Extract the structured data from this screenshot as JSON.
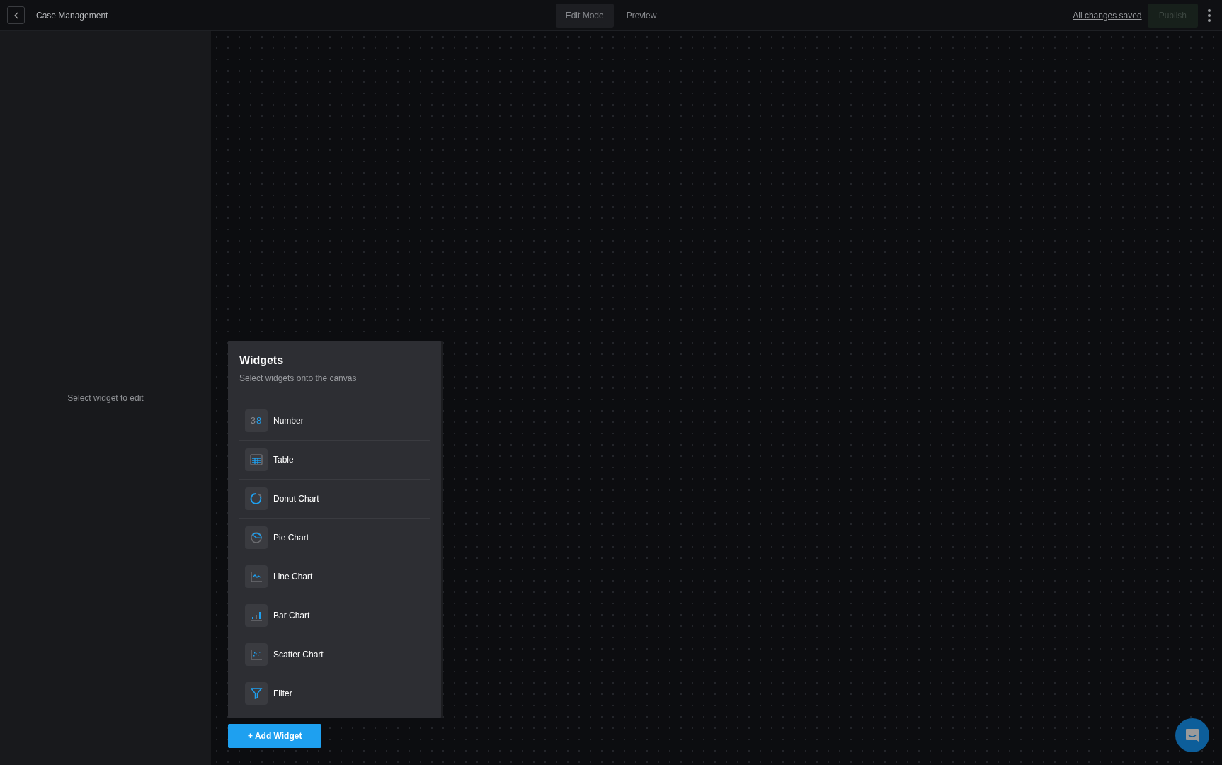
{
  "header": {
    "back_button": true,
    "title": "Case Management",
    "tabs": [
      {
        "label": "Edit Mode",
        "selected": true
      },
      {
        "label": "Preview",
        "selected": false
      }
    ],
    "save_status": "All changes saved",
    "publish": {
      "label": "Publish",
      "disabled": true
    }
  },
  "sidebar": {
    "empty_message": "Select widget to edit"
  },
  "widgets_panel": {
    "title": "Widgets",
    "subtitle": "Select widgets onto the canvas",
    "items": [
      {
        "kind": "number",
        "label": "Number",
        "icon_text": "38"
      },
      {
        "kind": "table",
        "label": "Table"
      },
      {
        "kind": "donut",
        "label": "Donut Chart"
      },
      {
        "kind": "pie",
        "label": "Pie Chart"
      },
      {
        "kind": "line",
        "label": "Line Chart"
      },
      {
        "kind": "bar",
        "label": "Bar Chart"
      },
      {
        "kind": "scatter",
        "label": "Scatter Chart"
      },
      {
        "kind": "filter",
        "label": "Filter"
      }
    ]
  },
  "add_widget_button": "+ Add Widget"
}
